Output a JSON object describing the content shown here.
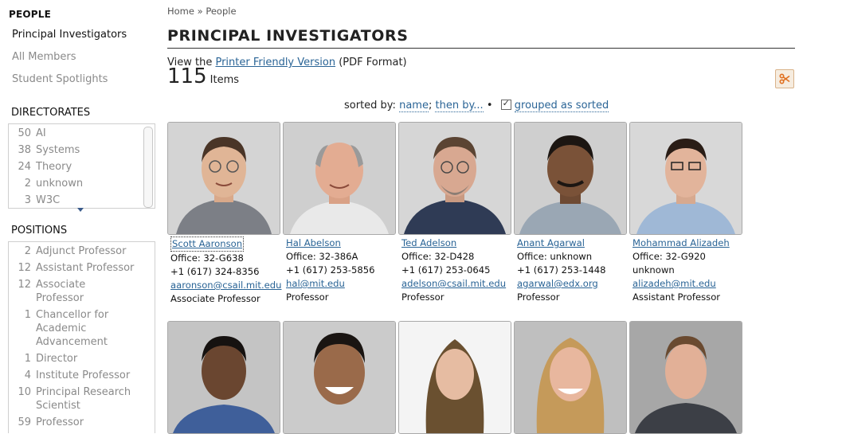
{
  "sidebar": {
    "people_heading": "PEOPLE",
    "links": [
      "Principal Investigators",
      "All Members",
      "Student Spotlights"
    ],
    "directorates_heading": "DIRECTORATES",
    "directorates": [
      {
        "count": "50",
        "label": "AI"
      },
      {
        "count": "38",
        "label": "Systems"
      },
      {
        "count": "24",
        "label": "Theory"
      },
      {
        "count": "2",
        "label": "unknown"
      },
      {
        "count": "3",
        "label": "W3C"
      }
    ],
    "positions_heading": "POSITIONS",
    "positions": [
      {
        "count": "2",
        "label": "Adjunct Professor"
      },
      {
        "count": "12",
        "label": "Assistant Professor"
      },
      {
        "count": "12",
        "label": "Associate Professor"
      },
      {
        "count": "1",
        "label": "Chancellor for Academic Advancement"
      },
      {
        "count": "1",
        "label": "Director"
      },
      {
        "count": "4",
        "label": "Institute Professor"
      },
      {
        "count": "10",
        "label": "Principal Research Scientist"
      },
      {
        "count": "59",
        "label": "Professor"
      }
    ]
  },
  "breadcrumb": {
    "home": "Home",
    "sep": "»",
    "current": "People"
  },
  "page_title": "PRINCIPAL INVESTIGATORS",
  "printer": {
    "prefix": "View the",
    "link": "Printer Friendly Version",
    "suffix": "(PDF Format)"
  },
  "count": {
    "number": "115",
    "label": "Items"
  },
  "sort": {
    "prefix": "sorted by:",
    "name": "name",
    "sep": ";",
    "then": "then by...",
    "bullet": "•",
    "grouped": "grouped as sorted"
  },
  "share_icon": "scissors-icon",
  "people": [
    {
      "name": "Scott Aaronson",
      "office": "Office: 32-G638",
      "phone": "+1 (617) 324-8356",
      "email": "aaronson@csail.mit.edu",
      "title": "Associate Professor"
    },
    {
      "name": "Hal Abelson",
      "office": "Office: 32-386A",
      "phone": "+1 (617) 253-5856",
      "email": "hal@mit.edu",
      "title": "Professor"
    },
    {
      "name": "Ted Adelson",
      "office": "Office: 32-D428",
      "phone": "+1 (617) 253-0645",
      "email": "adelson@csail.mit.edu",
      "title": "Professor"
    },
    {
      "name": "Anant Agarwal",
      "office": "Office: unknown",
      "phone": "+1 (617) 253-1448",
      "email": "agarwal@edx.org",
      "title": "Professor"
    },
    {
      "name": "Mohammad Alizadeh",
      "office": "Office: 32-G920",
      "phone": "unknown",
      "email": "alizadeh@mit.edu",
      "title": "Assistant Professor"
    }
  ],
  "colors": {
    "link": "#2a6496",
    "muted": "#8a8a8a",
    "accent_share": "#e07020"
  }
}
